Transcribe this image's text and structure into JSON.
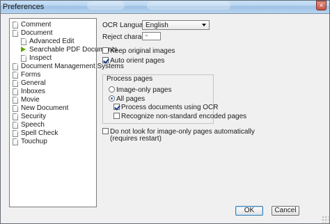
{
  "window": {
    "title": "Preferences",
    "close_glyph": "×"
  },
  "sidebar": {
    "items": [
      {
        "label": "Comment",
        "icon": "document-icon"
      },
      {
        "label": "Document",
        "icon": "document-icon"
      },
      {
        "label": "Advanced Edit",
        "icon": "document-icon"
      },
      {
        "label": "Searchable PDF Documents",
        "icon": "green-arrow-icon"
      },
      {
        "label": "Inspect",
        "icon": "document-icon"
      },
      {
        "label": "Document Management Systems",
        "icon": "document-icon"
      },
      {
        "label": "Forms",
        "icon": "document-icon"
      },
      {
        "label": "General",
        "icon": "document-icon"
      },
      {
        "label": "Inboxes",
        "icon": "document-icon"
      },
      {
        "label": "Movie",
        "icon": "document-icon"
      },
      {
        "label": "New Document",
        "icon": "document-icon"
      },
      {
        "label": "Security",
        "icon": "document-icon"
      },
      {
        "label": "Speech",
        "icon": "document-icon"
      },
      {
        "label": "Spell Check",
        "icon": "document-icon"
      },
      {
        "label": "Touchup",
        "icon": "document-icon"
      }
    ]
  },
  "settings": {
    "ocr_language_label": "OCR Language:",
    "ocr_language_value": "English",
    "reject_character_label": "Reject character:",
    "reject_character_value": "~",
    "keep_original_images_label": "Keep original images",
    "auto_orient_pages_label": "Auto orient pages",
    "process_pages_title": "Process pages",
    "image_only_pages_label": "Image-only pages",
    "all_pages_label": "All pages",
    "process_documents_using_ocr_label": "Process documents using OCR",
    "recognize_non_standard_label": "Recognize non-standard encoded pages",
    "do_not_look_label_line1": "Do not look for image-only pages automatically",
    "do_not_look_label_line2": "(requires restart)"
  },
  "buttons": {
    "ok": "OK",
    "cancel": "Cancel"
  },
  "colors": {
    "titlebar_blue": "#b7d4ef",
    "accent_blue": "#2b66c3",
    "arrow_green": "#5ea800"
  }
}
